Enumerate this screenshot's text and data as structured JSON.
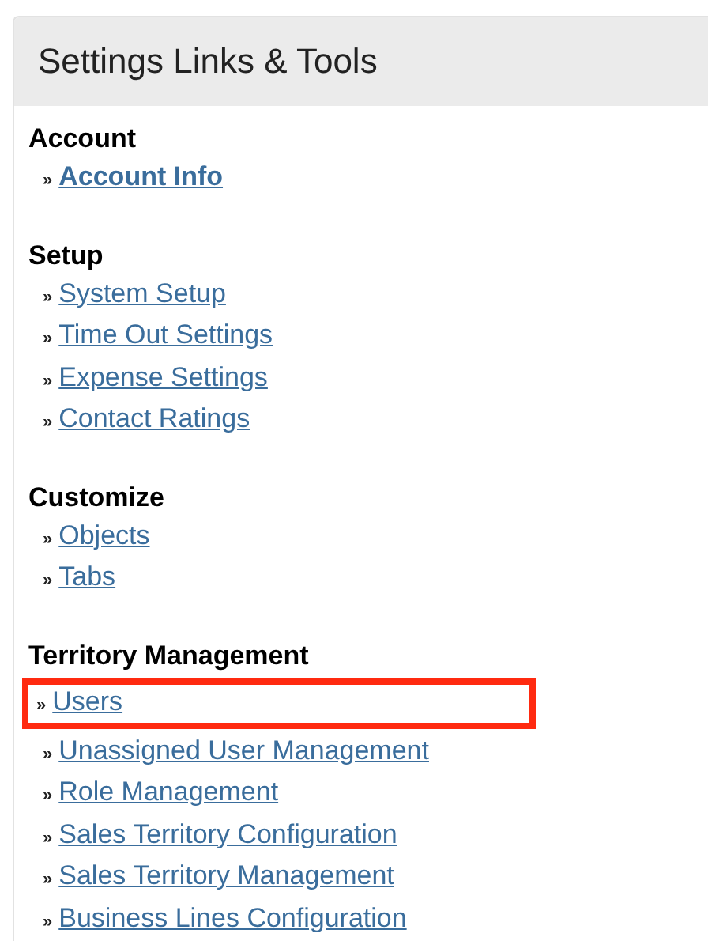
{
  "panel": {
    "title": "Settings Links & Tools"
  },
  "sections": [
    {
      "heading": "Account",
      "links": [
        {
          "bullet": "»",
          "label": "Account Info",
          "bold": true,
          "highlighted": false
        }
      ]
    },
    {
      "heading": "Setup",
      "links": [
        {
          "bullet": "»",
          "label": "System Setup",
          "bold": false,
          "highlighted": false
        },
        {
          "bullet": "»",
          "label": "Time Out Settings",
          "bold": false,
          "highlighted": false
        },
        {
          "bullet": "»",
          "label": "Expense Settings",
          "bold": false,
          "highlighted": false
        },
        {
          "bullet": "»",
          "label": "Contact Ratings",
          "bold": false,
          "highlighted": false
        }
      ]
    },
    {
      "heading": "Customize",
      "links": [
        {
          "bullet": "»",
          "label": "Objects",
          "bold": false,
          "highlighted": false
        },
        {
          "bullet": "»",
          "label": "Tabs",
          "bold": false,
          "highlighted": false
        }
      ]
    },
    {
      "heading": "Territory Management",
      "links": [
        {
          "bullet": "»",
          "label": "Users",
          "bold": false,
          "highlighted": true
        },
        {
          "bullet": "»",
          "label": "Unassigned User Management",
          "bold": false,
          "highlighted": false
        },
        {
          "bullet": "»",
          "label": "Role Management",
          "bold": false,
          "highlighted": false
        },
        {
          "bullet": "»",
          "label": "Sales Territory Configuration",
          "bold": false,
          "highlighted": false
        },
        {
          "bullet": "»",
          "label": "Sales Territory Management",
          "bold": false,
          "highlighted": false
        },
        {
          "bullet": "»",
          "label": "Business Lines Configuration",
          "bold": false,
          "highlighted": false
        }
      ]
    }
  ]
}
